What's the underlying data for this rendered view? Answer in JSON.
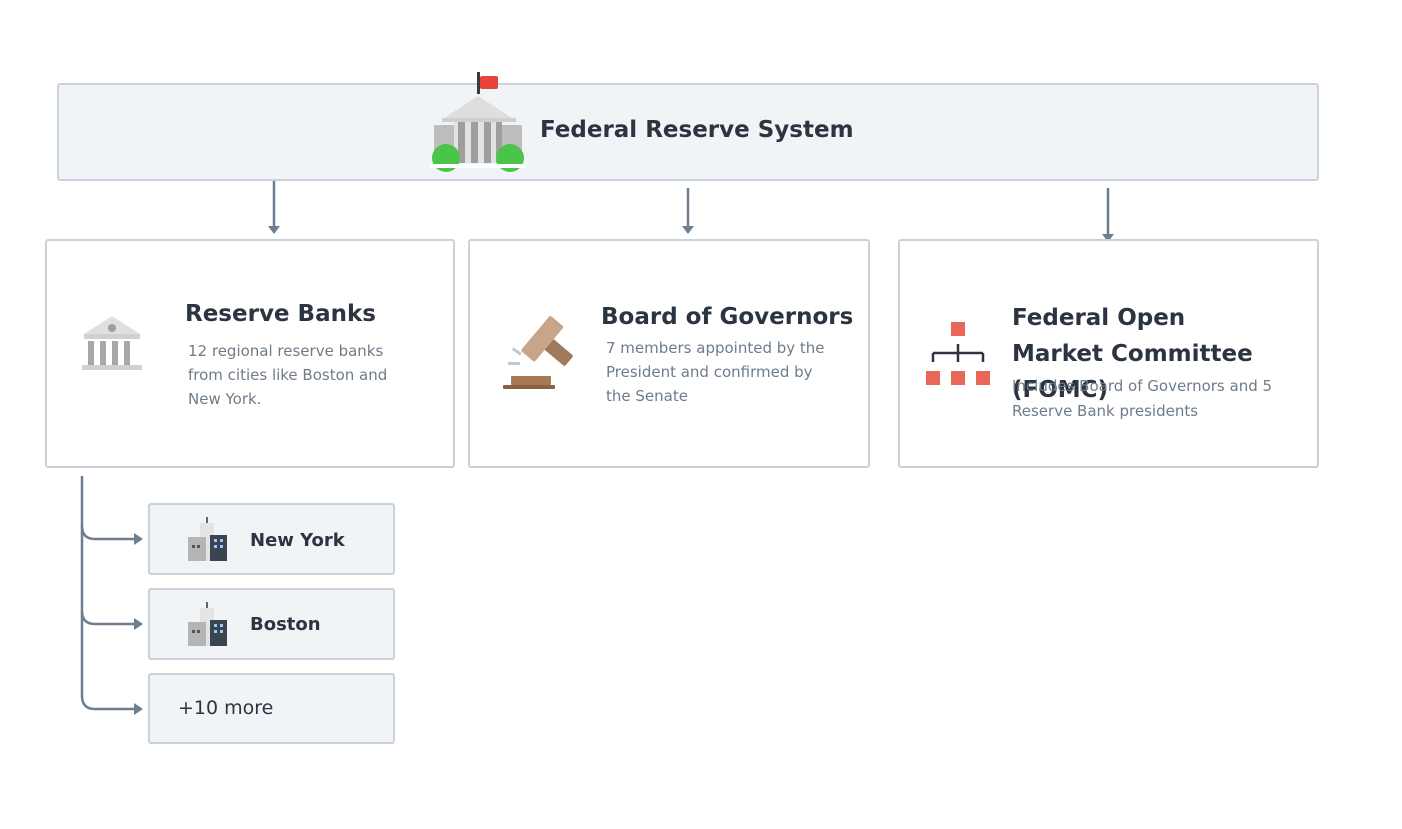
{
  "root": {
    "title": "Federal Reserve System",
    "icon": "federal-building-icon"
  },
  "cards": [
    {
      "title": "Reserve Banks",
      "description": "12 regional reserve banks from cities like Boston and New York.",
      "icon": "bank-icon"
    },
    {
      "title": "Board of Governors",
      "description": "7 members appointed by the President and confirmed by the Senate",
      "icon": "gavel-icon"
    },
    {
      "title": "Federal Open Market Committee (FOMC)",
      "description": "Includes Board of Governors and 5 Reserve Bank presidents",
      "icon": "org-chart-icon"
    }
  ],
  "banks": [
    {
      "label": "New York",
      "icon": "city-buildings-icon"
    },
    {
      "label": "Boston",
      "icon": "city-buildings-icon"
    },
    {
      "label": "+10 more"
    }
  ],
  "colors": {
    "box_fill": "#f0f4f7",
    "box_border": "#c9d2da",
    "connector": "#6e7e8e",
    "title_text": "#2b3440",
    "muted_text": "#6e7c89",
    "flag": "#e8443a",
    "bushes": "#4cc44a",
    "gavel": "#b08a6a",
    "org_chart_nodes": "#e8665a"
  }
}
